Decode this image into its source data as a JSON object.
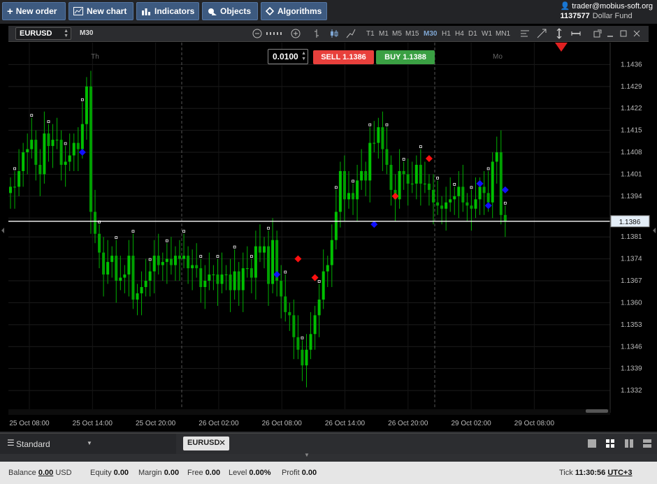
{
  "toolbar": {
    "new_order": "New order",
    "new_chart": "New chart",
    "indicators": "Indicators",
    "objects": "Objects",
    "algorithms": "Algorithms"
  },
  "account": {
    "user": "trader@mobius-soft.org",
    "id": "1137577",
    "fund": "Dollar Fund"
  },
  "chart_window": {
    "symbol": "EURUSD",
    "timeframe": "M30",
    "timeframes": [
      "T1",
      "M1",
      "M5",
      "M15",
      "M30",
      "H1",
      "H4",
      "D1",
      "W1",
      "MN1"
    ],
    "active_timeframe": "M30",
    "lot": "0.0100",
    "sell_label": "SELL 1.1386",
    "buy_label": "BUY 1.1388",
    "day_labels": [
      "Th",
      "Mo"
    ]
  },
  "chart_data": {
    "type": "candlestick",
    "symbol": "EURUSD",
    "ylim": [
      1.1326,
      1.1443
    ],
    "yticks": [
      "1.1436",
      "1.1429",
      "1.1422",
      "1.1415",
      "1.1408",
      "1.1401",
      "1.1394",
      "1.1387",
      "1.1381",
      "1.1374",
      "1.1367",
      "1.1360",
      "1.1353",
      "1.1346",
      "1.1339",
      "1.1332"
    ],
    "xticks": [
      "25 Oct 08:00",
      "25 Oct 14:00",
      "25 Oct 20:00",
      "26 Oct 02:00",
      "26 Oct 08:00",
      "26 Oct 14:00",
      "26 Oct 20:00",
      "29 Oct 02:00",
      "29 Oct 08:00"
    ],
    "current_price": 1.1386,
    "current_price_label": "1.1386",
    "colors": {
      "bull": "#00c000",
      "bear": "#00a000",
      "price_line": "#ffffff",
      "buy_marker": "#1010ff",
      "sell_marker": "#ff1010",
      "alert": "#e02020"
    },
    "closes": [
      1.1397,
      1.1397,
      1.1402,
      1.1408,
      1.1409,
      1.1412,
      1.1404,
      1.1401,
      1.1414,
      1.141,
      1.1412,
      1.1412,
      1.1404,
      1.1405,
      1.1407,
      1.1411,
      1.1409,
      1.1417,
      1.1429,
      1.1389,
      1.1382,
      1.1376,
      1.1369,
      1.1373,
      1.1375,
      1.1367,
      1.1368,
      1.1369,
      1.1375,
      1.1361,
      1.1363,
      1.1365,
      1.1367,
      1.137,
      1.1375,
      1.1372,
      1.1373,
      1.1374,
      1.1372,
      1.1375,
      1.1374,
      1.1375,
      1.1371,
      1.1372,
      1.1371,
      1.1365,
      1.1367,
      1.1369,
      1.1369,
      1.1366,
      1.1369,
      1.1369,
      1.1364,
      1.137,
      1.1364,
      1.1371,
      1.1371,
      1.1368,
      1.1378,
      1.1376,
      1.1378,
      1.1366,
      1.138,
      1.1367,
      1.1362,
      1.1357,
      1.1356,
      1.1349,
      1.1345,
      1.134,
      1.1345,
      1.135,
      1.1356,
      1.1361,
      1.137,
      1.1372,
      1.138,
      1.1389,
      1.1402,
      1.1393,
      1.1395,
      1.1393,
      1.1399,
      1.1402,
      1.1399,
      1.1411,
      1.1411,
      1.1416,
      1.1409,
      1.1404,
      1.1396,
      1.1393,
      1.1402,
      1.1401,
      1.1398,
      1.1398,
      1.1404,
      1.1398,
      1.1398,
      1.1396,
      1.1392,
      1.1391,
      1.139,
      1.1392,
      1.1393,
      1.1394,
      1.1397,
      1.1392,
      1.1391,
      1.139,
      1.1393,
      1.1397,
      1.1395,
      1.1392,
      1.1405,
      1.1408,
      1.1388,
      1.1386
    ],
    "buy_signals": [
      "1.1408",
      "1.1385",
      "1.1369",
      "1.1398",
      "1.1391",
      "1.1396"
    ],
    "sell_signals": [
      "1.1394",
      "1.1406",
      "1.1374",
      "1.1368"
    ]
  },
  "bottom": {
    "layout_name": "Standard",
    "tab_symbol": "EURUSD"
  },
  "status": {
    "balance_label": "Balance",
    "balance": "0.00",
    "currency": "USD",
    "equity_label": "Equity",
    "equity": "0.00",
    "margin_label": "Margin",
    "margin": "0.00",
    "free_label": "Free",
    "free": "0.00",
    "level_label": "Level",
    "level": "0.00%",
    "profit_label": "Profit",
    "profit": "0.00",
    "tick_label": "Tick",
    "time": "11:30:56",
    "tz": "UTC+3"
  }
}
